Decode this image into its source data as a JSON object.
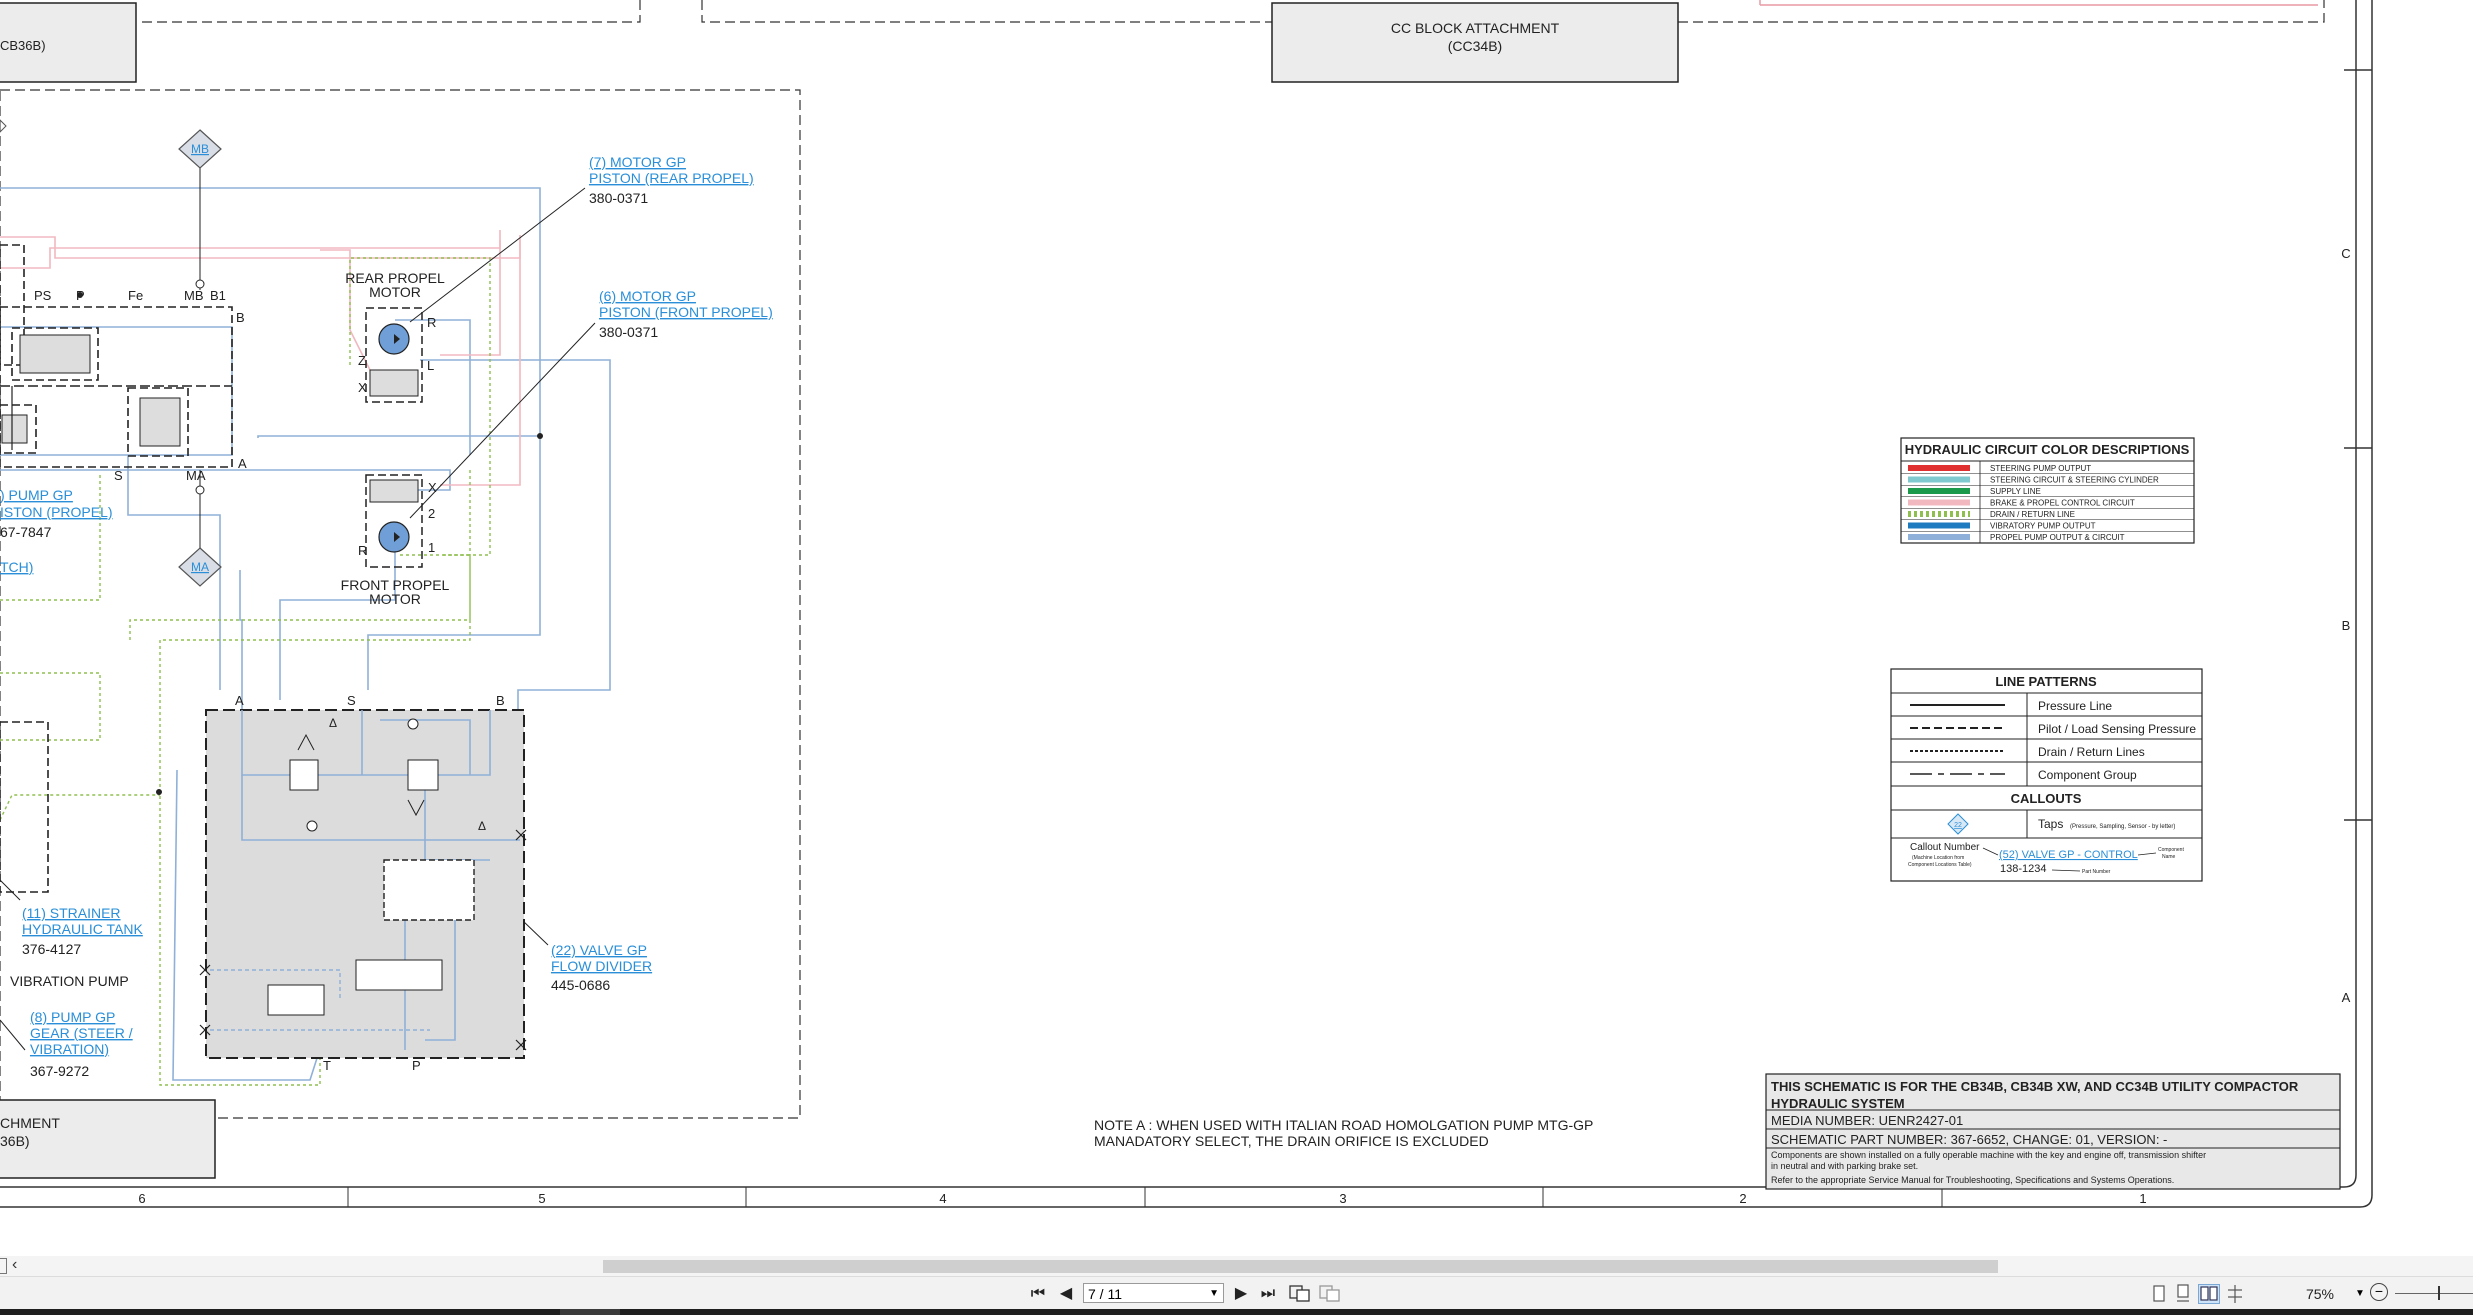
{
  "schematic": {
    "top_left_box": "CB36B)",
    "cc_block": {
      "line1": "CC BLOCK ATTACHMENT",
      "line2": "(CC34B)"
    },
    "bottom_left_box": {
      "line1": "CHMENT",
      "line2": "36B)"
    },
    "tap_mb": "MB",
    "tap_ma": "MA",
    "rear_motor": {
      "line1": "REAR PROPEL",
      "line2": "MOTOR"
    },
    "front_motor": {
      "line1": "FRONT PROPEL",
      "line2": "MOTOR"
    },
    "callout_7": {
      "line1": "(7) MOTOR GP",
      "line2": "PISTON (REAR PROPEL)",
      "part": "380-0371"
    },
    "callout_6": {
      "line1": "(6) MOTOR GP",
      "line2": "PISTON (FRONT PROPEL)",
      "part": "380-0371"
    },
    "callout_pump": {
      "line1": ") PUMP GP",
      "line2": "ISTON (PROPEL)",
      "part": "67-7847"
    },
    "callout_tch": "TCH)",
    "callout_11": {
      "line1": "(11) STRAINER",
      "line2": "HYDRAULIC TANK",
      "part": "376-4127"
    },
    "vibration_pump": "VIBRATION PUMP",
    "callout_8": {
      "line1": "(8) PUMP GP",
      "line2": "GEAR (STEER /",
      "line3": "VIBRATION)",
      "part": "367-9272"
    },
    "callout_22": {
      "line1": "(22) VALVE GP",
      "line2": "FLOW DIVIDER",
      "part": "445-0686"
    },
    "port_labels": {
      "ps": "PS",
      "p": "P",
      "fe": "Fe",
      "mb": "MB",
      "b1": "B1",
      "b": "B",
      "a": "A",
      "s": "S",
      "ma": "MA",
      "r": "R",
      "l": "L",
      "x": "X",
      "z": "Z",
      "one": "1",
      "two": "2",
      "fa": "A",
      "fs": "S",
      "fb": "B",
      "ft": "T",
      "fp": "P",
      "delta": "Δ"
    },
    "note_a": {
      "line1": "NOTE A : WHEN USED WITH ITALIAN ROAD HOMOLGATION PUMP MTG-GP",
      "line2": "MANADATORY SELECT, THE DRAIN ORIFICE IS EXCLUDED"
    },
    "color_legend": {
      "title": "HYDRAULIC CIRCUIT COLOR DESCRIPTIONS",
      "rows": [
        {
          "label": "STEERING PUMP OUTPUT",
          "color": "#e03030",
          "style": "solid"
        },
        {
          "label": "STEERING CIRCUIT & STEERING CYLINDER",
          "color": "#7fc9cf",
          "style": "solid"
        },
        {
          "label": "SUPPLY LINE",
          "color": "#1a9a4a",
          "style": "solid"
        },
        {
          "label": "BRAKE & PROPEL CONTROL CIRCUIT",
          "color": "#f2b8c0",
          "style": "solid"
        },
        {
          "label": "DRAIN / RETURN LINE",
          "color": "#8fbf4f",
          "style": "dotted"
        },
        {
          "label": "VIBRATORY PUMP OUTPUT",
          "color": "#1f7bbf",
          "style": "solid"
        },
        {
          "label": "PROPEL PUMP OUTPUT & CIRCUIT",
          "color": "#8fb0d8",
          "style": "solid"
        }
      ]
    },
    "line_patterns": {
      "title": "LINE PATTERNS",
      "rows": [
        "Pressure Line",
        "Pilot / Load Sensing Pressure",
        "Drain / Return Lines",
        "Component Group"
      ],
      "callouts_title": "CALLOUTS",
      "taps_label": "Taps",
      "taps_note": "(Pressure, Sampling, Sensor - by letter)",
      "tap_symbol": "22",
      "callout_number": "Callout Number",
      "callout_note1": "(Machine Location from",
      "callout_note2": "Component Locations Table)",
      "example_callout": "(52) VALVE GP - CONTROL",
      "example_part": "138-1234",
      "component_name1": "Component",
      "component_name2": "Name",
      "part_number": "Part Number"
    },
    "title_block": {
      "line1": "THIS SCHEMATIC IS FOR THE CB34B, CB34B XW, AND CC34B UTILITY COMPACTOR",
      "line2": "HYDRAULIC SYSTEM",
      "media": "MEDIA NUMBER: UENR2427-01",
      "part": "SCHEMATIC PART NUMBER: 367-6652, CHANGE: 01, VERSION: -",
      "note1": "Components are shown installed on a fully operable machine with the key and engine off, transmission shifter",
      "note2": "in neutral and with parking brake set.",
      "note3": "Refer to the appropriate Service Manual for Troubleshooting, Specifications and Systems Operations."
    },
    "zone_cols": [
      "6",
      "5",
      "4",
      "3",
      "2",
      "1"
    ],
    "zone_rows": [
      "C",
      "B",
      "A"
    ]
  },
  "viewer": {
    "page": "7 / 11",
    "zoom": "75%"
  }
}
